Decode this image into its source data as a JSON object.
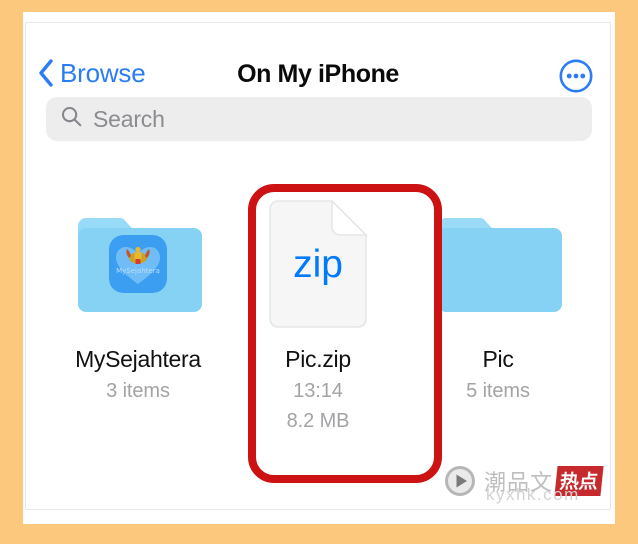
{
  "theme": {
    "background_color": "#fcc87d",
    "card_background": "#ffffff",
    "accent_blue": "#2b7cf6",
    "zip_blue": "#007aff",
    "folder_blue": "#85d2f5",
    "annotation_red": "#cc1212",
    "search_field_bg": "#ededee",
    "meta_gray": "#a3a3a6"
  },
  "nav": {
    "back_label": "Browse",
    "back_icon": "chevron-left-icon",
    "title": "On My iPhone",
    "more_icon": "more-circle-icon"
  },
  "search": {
    "icon": "search-icon",
    "placeholder": "Search",
    "value": ""
  },
  "files": [
    {
      "name": "MySejahtera",
      "kind": "folder",
      "icon": "folder-icon",
      "badge_icon": "mysejahtera-app-icon",
      "badge_label": "MySejahtera",
      "meta1": "3 items",
      "meta2": "",
      "selected": false
    },
    {
      "name": "Pic.zip",
      "kind": "file",
      "icon": "zip-document-icon",
      "icon_label": "zip",
      "meta1": "13:14",
      "meta2": "8.2 MB",
      "selected": true
    },
    {
      "name": "Pic",
      "kind": "folder",
      "icon": "folder-icon",
      "meta1": "5 items",
      "meta2": "",
      "selected": false
    }
  ],
  "annotation": {
    "shape": "rounded-rectangle",
    "color": "#cc1212",
    "targets": "Pic.zip"
  },
  "watermark": {
    "play_icon": "play-circle-icon",
    "cn_text": "潮品文",
    "badge_text": "热点",
    "url": "kyxhk.com"
  }
}
